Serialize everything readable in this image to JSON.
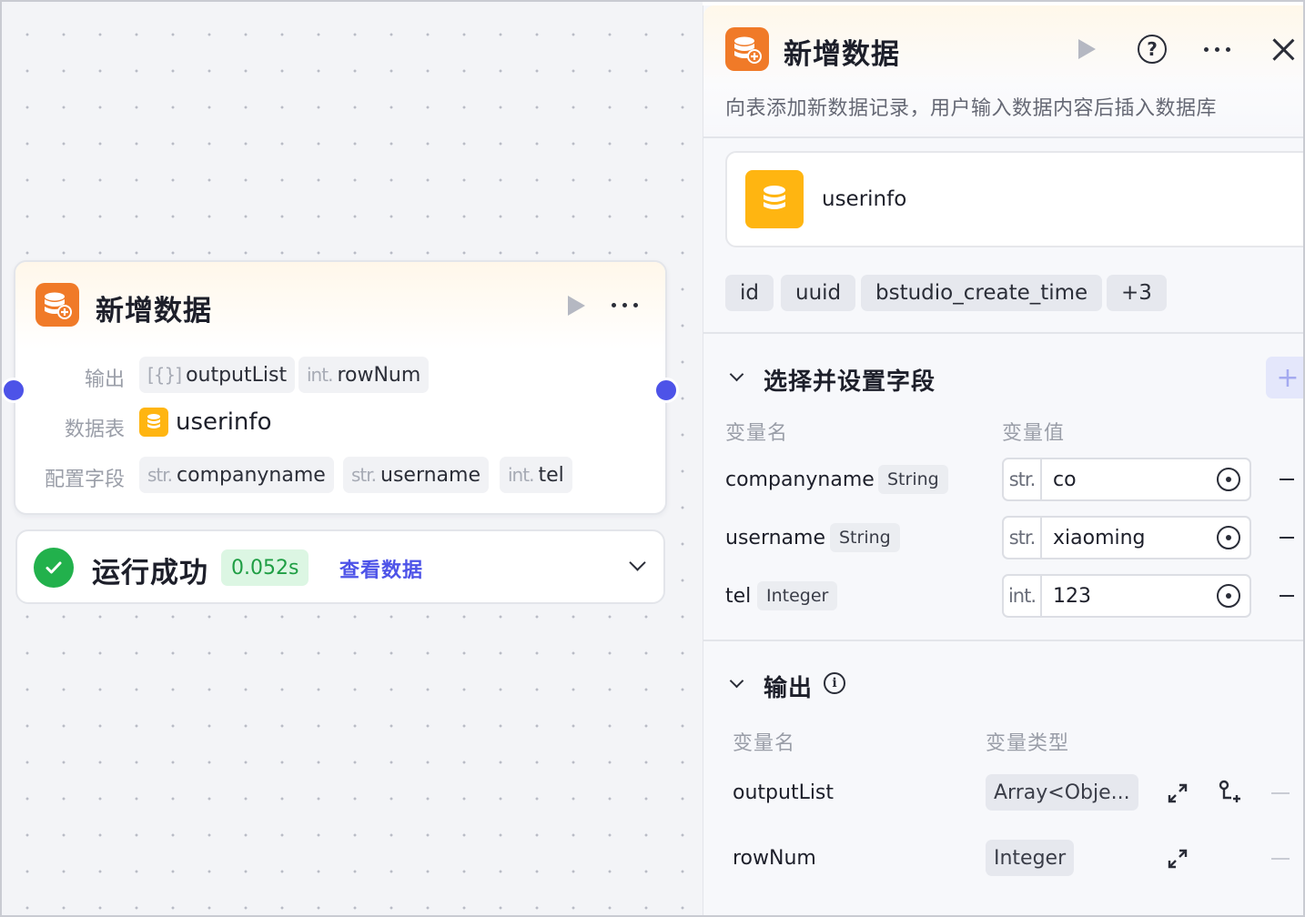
{
  "node": {
    "title": "新增数据",
    "rows": {
      "output_label": "输出",
      "table_label": "数据表",
      "fields_label": "配置字段"
    },
    "outputs": [
      {
        "prefix": "[{}]",
        "name": "outputList"
      },
      {
        "prefix": "int.",
        "name": "rowNum"
      }
    ],
    "table": "userinfo",
    "fields": [
      {
        "prefix": "str.",
        "name": "companyname"
      },
      {
        "prefix": "str.",
        "name": "username"
      },
      {
        "prefix": "int.",
        "name": "tel"
      }
    ]
  },
  "result": {
    "status": "运行成功",
    "duration": "0.052s",
    "view_link": "查看数据"
  },
  "panel": {
    "title": "新增数据",
    "description": "向表添加新数据记录，用户输入数据内容后插入数据库",
    "help": "?",
    "table_name": "userinfo",
    "columns": [
      "id",
      "uuid",
      "bstudio_create_time",
      "+3"
    ],
    "fields_section": {
      "title": "选择并设置字段",
      "add": "+",
      "col_name": "变量名",
      "col_value": "变量值",
      "rows": [
        {
          "name": "companyname",
          "type": "String",
          "prefix": "str.",
          "value": "co"
        },
        {
          "name": "username",
          "type": "String",
          "prefix": "str.",
          "value": "xiaoming"
        },
        {
          "name": "tel",
          "type": "Integer",
          "prefix": "int.",
          "value": "123"
        }
      ]
    },
    "output_section": {
      "title": "输出",
      "info": "i",
      "col_name": "变量名",
      "col_type": "变量类型",
      "rows": [
        {
          "name": "outputList",
          "type": "Array<Obje..."
        },
        {
          "name": "rowNum",
          "type": "Integer"
        }
      ]
    }
  },
  "colors": {
    "accent": "#4d53e8",
    "node_icon": "#f07a28",
    "table_icon": "#ffb511",
    "success": "#22b14c"
  },
  "icons": [
    "database-add-icon",
    "play-icon",
    "more-icon",
    "help-icon",
    "close-icon",
    "database-icon",
    "chevron-down-icon",
    "info-icon",
    "variable-ref-icon",
    "minus-icon",
    "expand-icon",
    "link-variable-icon",
    "plus-icon",
    "check-icon"
  ]
}
